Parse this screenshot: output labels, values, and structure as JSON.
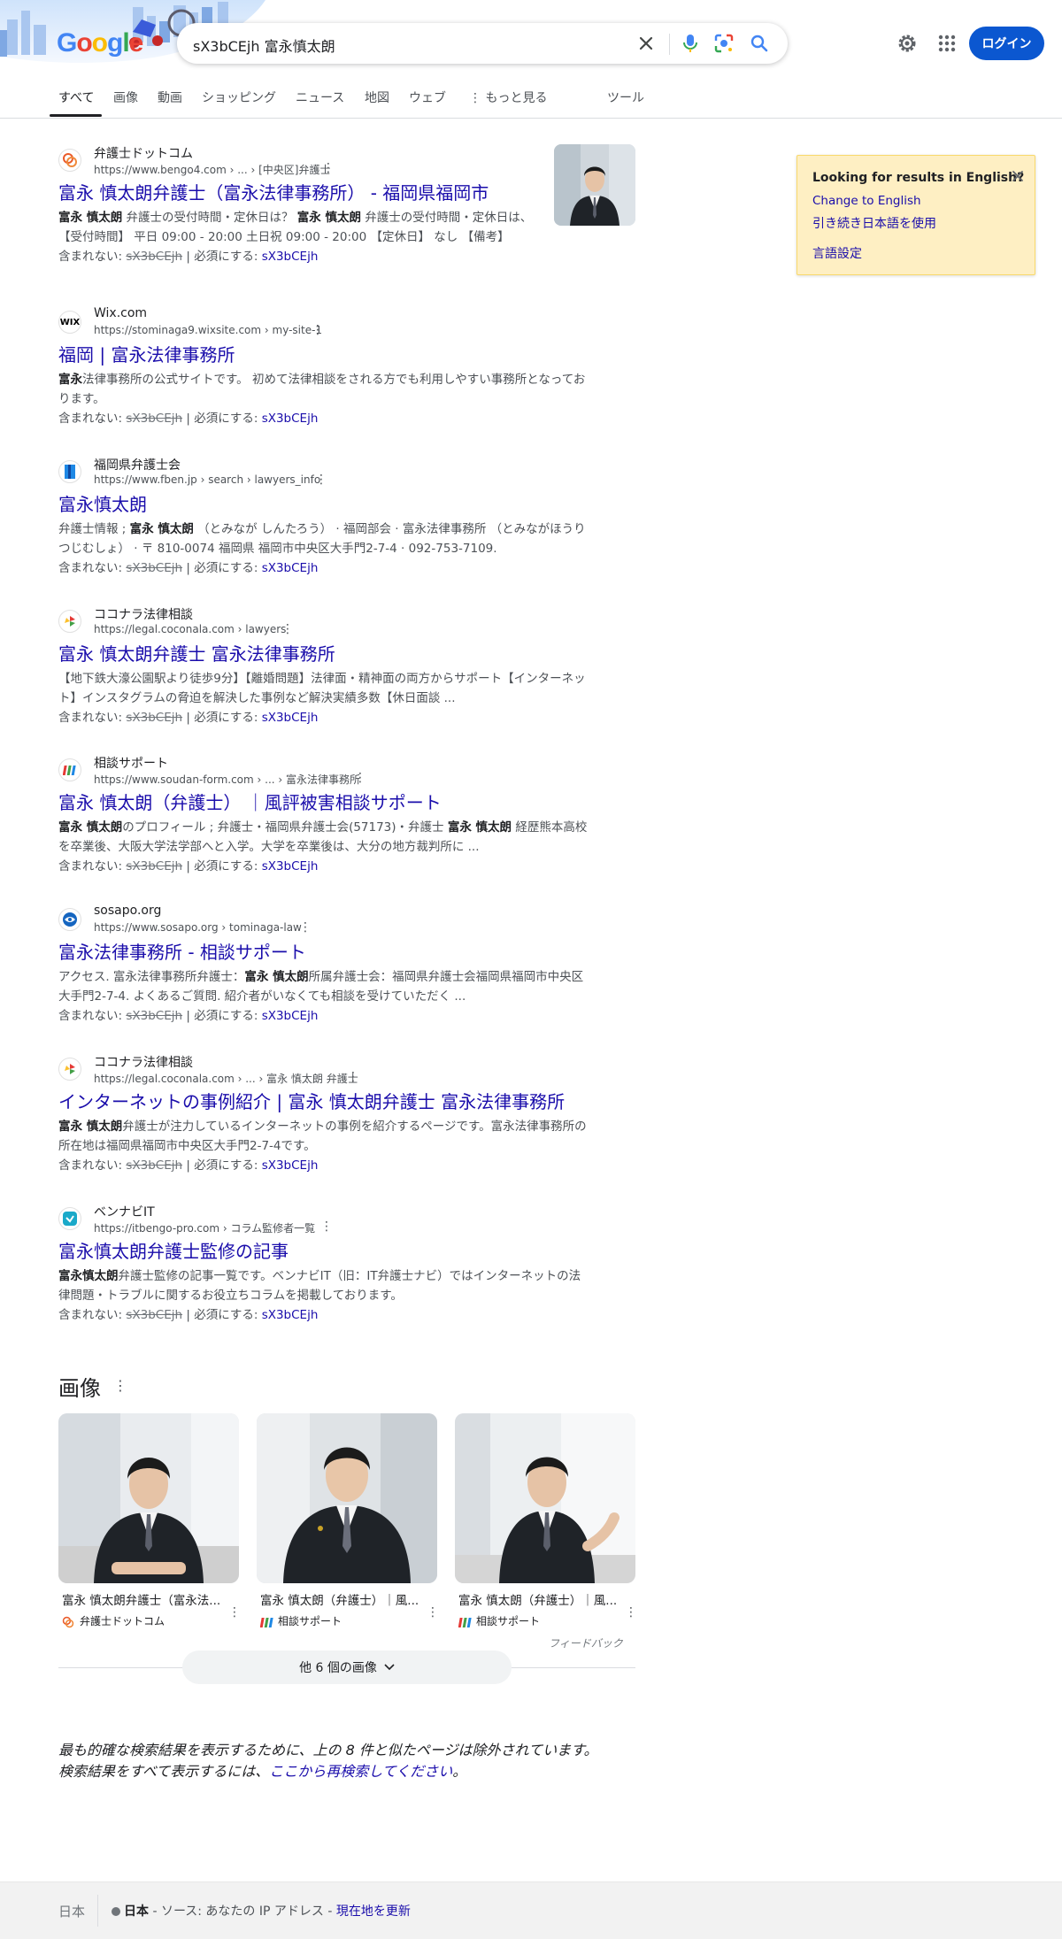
{
  "header": {
    "logo_letters": [
      "G",
      "o",
      "o",
      "g",
      "l",
      "e"
    ],
    "search_query": "sX3bCEjh 富永慎太朗",
    "login_label": "ログイン"
  },
  "tabs": [
    {
      "label": "すべて",
      "active": true
    },
    {
      "label": "画像"
    },
    {
      "label": "動画"
    },
    {
      "label": "ショッピング"
    },
    {
      "label": "ニュース"
    },
    {
      "label": "地図"
    },
    {
      "label": "ウェブ"
    },
    {
      "label": "もっと見る"
    },
    {
      "label": "ツール"
    }
  ],
  "results_common": {
    "missing_label": "含まれない:",
    "missing_term": "sX3bCEjh",
    "required_label": "| 必須にする:",
    "required_term": "sX3bCEjh"
  },
  "results": [
    {
      "site": "弁護士ドットコム",
      "url": "https://www.bengo4.com › ... › [中央区]弁護士",
      "title": "富永 慎太朗弁護士（富永法律事務所） - 福岡県福岡市",
      "snippet_1": "富永 慎太朗",
      "snippet_2": " 弁護士の受付時間・定休日は？ ",
      "snippet_3": "富永 慎太朗",
      "snippet_4": " 弁護士の受付時間・定休日は、【受付時間】 平日 09:00 - 20:00 土日祝 09:00 - 20:00 【定休日】 なし 【備考】"
    },
    {
      "site": "Wix.com",
      "favicon_text": "WIX",
      "url": "https://stominaga9.wixsite.com › my-site-1",
      "title": "福岡 | 富永法律事務所",
      "snippet_1": "富永",
      "snippet_2": "法律事務所の公式サイトです。 初めて法律相談をされる方でも利用しやすい事務所となっております。"
    },
    {
      "site": "福岡県弁護士会",
      "url": "https://www.fben.jp › search › lawyers_info",
      "title": "富永慎太朗",
      "snippet_1": "弁護士情報 ; ",
      "snippet_2": "富永 慎太朗",
      "snippet_3": " （とみなが しんたろう） · 福岡部会 · 富永法律事務所 （とみながほうりつじむしょ） · 〒 810-0074 福岡県 福岡市中央区大手門2-7-4 · 092-753-7109."
    },
    {
      "site": "ココナラ法律相談",
      "url": "https://legal.coconala.com › lawyers",
      "title": "富永 慎太朗弁護士 富永法律事務所",
      "snippet_1": "【地下鉄大濠公園駅より徒歩9分】【離婚問題】法律面・精神面の両方からサポート【インターネット】インスタグラムの脅迫を解決した事例など解決実績多数【休日面談 ..."
    },
    {
      "site": "相談サポート",
      "url": "https://www.soudan-form.com › ... › 富永法律事務所",
      "title": "富永 慎太朗（弁護士） ｜風評被害相談サポート",
      "snippet_1": "富永 慎太朗",
      "snippet_2": "のプロフィール ; 弁護士・福岡県弁護士会(57173)・弁護士 ",
      "snippet_3": "富永 慎太朗",
      "snippet_4": " 経歴熊本高校を卒業後、大阪大学法学部へと入学。大学を卒業後は、大分の地方裁判所に ..."
    },
    {
      "site": "sosapo.org",
      "url": "https://www.sosapo.org › tominaga-law",
      "title": "富永法律事務所 - 相談サポート",
      "snippet_1": "アクセス. 富永法律事務所弁護士：",
      "snippet_2": "富永 慎太朗",
      "snippet_3": "所属弁護士会：福岡県弁護士会福岡県福岡市中央区大手門2-7-4. よくあるご質問. 紹介者がいなくても相談を受けていただく ..."
    },
    {
      "site": "ココナラ法律相談",
      "url": "https://legal.coconala.com › ... › 富永 慎太朗 弁護士",
      "title": "インターネットの事例紹介 | 富永 慎太朗弁護士 富永法律事務所",
      "snippet_1": "富永 慎太朗",
      "snippet_2": "弁護士が注力しているインターネットの事例を紹介するページです。富永法律事務所の所在地は福岡県福岡市中央区大手門2-7-4です。"
    },
    {
      "site": "ベンナビIT",
      "url": "https://itbengo-pro.com › コラム監修者一覧",
      "title": "富永慎太朗弁護士監修の記事",
      "snippet_1": "富永慎太朗",
      "snippet_2": "弁護士監修の記事一覧です。ベンナビIT（旧：IT弁護士ナビ）ではインターネットの法律問題・トラブルに関するお役立ちコラムを掲載しております。"
    }
  ],
  "lang_panel": {
    "title": "Looking for results in English?",
    "change": "Change to English",
    "keep": "引き続き日本語を使用",
    "settings": "言語設定"
  },
  "images": {
    "heading": "画像",
    "cards": [
      {
        "caption": "富永 慎太朗弁護士（富永法...",
        "source": "弁護士ドットコム"
      },
      {
        "caption": "富永 慎太朗（弁護士）｜風...",
        "source": "相談サポート"
      },
      {
        "caption": "富永 慎太朗（弁護士）｜風...",
        "source": "相談サポート"
      }
    ],
    "feedback": "フィードバック",
    "more_label": "他 6 個の画像"
  },
  "omitted": {
    "line1": "最も的確な検索結果を表示するために、上の 8 件と似たページは除外されています。",
    "line2_pre": "検索結果をすべて表示するには、",
    "line2_link": "ここから再検索してください",
    "line2_post": "。"
  },
  "footer": {
    "country": "日本",
    "location_bold": "日本",
    "location_source": " - ソース: あなたの IP アドレス - ",
    "update_link": "現在地を更新"
  },
  "colors": {
    "link": "#1a0dab",
    "login_button": "#0b57d0",
    "lang_panel_bg": "#feefc3"
  }
}
